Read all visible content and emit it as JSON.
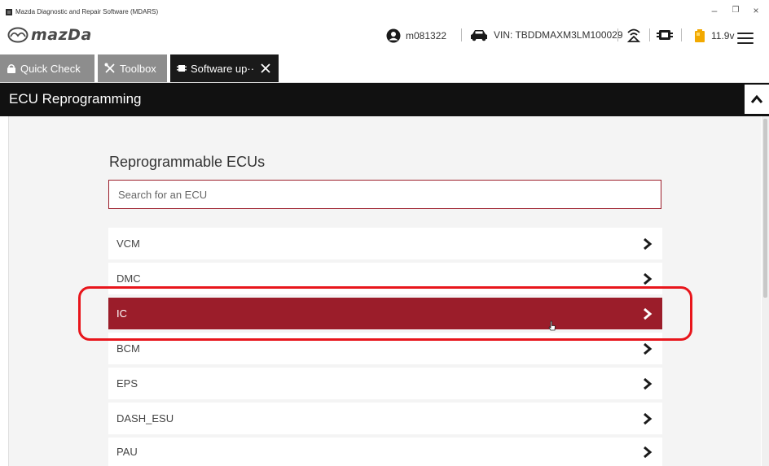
{
  "window": {
    "title": "Mazda Diagnostic and Repair Software (MDARS)",
    "controls": [
      "–",
      "❐",
      "×"
    ]
  },
  "header": {
    "brand": "mazDa",
    "user_id": "m081322",
    "vin": "VIN: TBDDMAXM3LM100029",
    "voltage": "11.9v"
  },
  "tabs": [
    {
      "label": "Quick Check",
      "icon": "lock-icon",
      "active": false
    },
    {
      "label": "Toolbox",
      "icon": "tools-icon",
      "active": false
    },
    {
      "label": "Software up··",
      "icon": "chip-icon",
      "active": true
    }
  ],
  "section": {
    "title": "ECU Reprogramming"
  },
  "ecu_list": {
    "title": "Reprogrammable ECUs",
    "search_placeholder": "Search for an ECU",
    "items": [
      {
        "label": "VCM",
        "selected": false
      },
      {
        "label": "DMC",
        "selected": false
      },
      {
        "label": "IC",
        "selected": true
      },
      {
        "label": "BCM",
        "selected": false
      },
      {
        "label": "EPS",
        "selected": false
      },
      {
        "label": "DASH_ESU",
        "selected": false
      },
      {
        "label": "PAU",
        "selected": false
      }
    ]
  },
  "colors": {
    "accent": "#9b1d2a",
    "annotation": "#e8151b",
    "section_bg": "#111111",
    "tab_inactive": "#8d8d8d",
    "tab_active": "#1a1a1a"
  }
}
